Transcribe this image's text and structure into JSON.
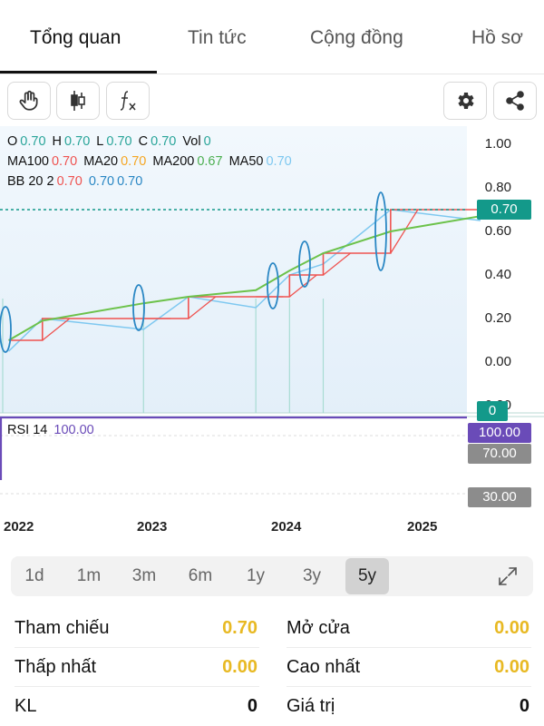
{
  "tabs": [
    {
      "label": "Tổng quan",
      "active": true
    },
    {
      "label": "Tin tức",
      "active": false
    },
    {
      "label": "Cộng đồng",
      "active": false
    },
    {
      "label": "Hồ sơ",
      "active": false
    }
  ],
  "toolbar": {
    "icons": [
      "hand-icon",
      "candlestick-icon",
      "function-icon",
      "gear-icon",
      "share-icon"
    ]
  },
  "legend": {
    "o_label": "O",
    "o_val": "0.70",
    "h_label": "H",
    "h_val": "0.70",
    "l_label": "L",
    "l_val": "0.70",
    "c_label": "C",
    "c_val": "0.70",
    "vol_label": "Vol",
    "vol_val": "0",
    "ma100_label": "MA100",
    "ma100_val": "0.70",
    "ma20_label": "MA20",
    "ma20_val": "0.70",
    "ma200_label": "MA200",
    "ma200_val": "0.67",
    "ma50_label": "MA50",
    "ma50_val": "0.70",
    "bb_label": "BB 20 2",
    "bb_upper": "0.70",
    "bb_mid": "0.70",
    "bb_lower": "0.70"
  },
  "price_axis": {
    "ticks": [
      "1.00",
      "0.80",
      "0.60",
      "0.40",
      "0.20",
      "0.00",
      "-0.20"
    ],
    "current_price": "0.70",
    "volume_badge": "0"
  },
  "rsi": {
    "label": "RSI 14",
    "value": "100.00",
    "upper_band": "70.00",
    "lower_band": "30.00"
  },
  "years": [
    "2022",
    "2023",
    "2024",
    "2025"
  ],
  "ranges": [
    {
      "label": "1d",
      "active": false
    },
    {
      "label": "1m",
      "active": false
    },
    {
      "label": "3m",
      "active": false
    },
    {
      "label": "6m",
      "active": false
    },
    {
      "label": "1y",
      "active": false
    },
    {
      "label": "3y",
      "active": false
    },
    {
      "label": "5y",
      "active": true
    }
  ],
  "stats": {
    "ref_label": "Tham chiếu",
    "ref_val": "0.70",
    "open_label": "Mở cửa",
    "open_val": "0.00",
    "low_label": "Thấp nhất",
    "low_val": "0.00",
    "high_label": "Cao nhất",
    "high_val": "0.00",
    "vol_label": "KL",
    "vol_val": "0",
    "value_label": "Giá trị",
    "value_val": "0"
  },
  "chart_data": {
    "type": "line",
    "ylim": [
      -0.2,
      1.0
    ],
    "series": [
      {
        "name": "C",
        "values": [
          0.1,
          0.2,
          0.2,
          0.3,
          0.3,
          0.4,
          0.5,
          0.7,
          0.7
        ]
      },
      {
        "name": "MA200",
        "values": [
          0.1,
          0.19,
          0.27,
          0.3,
          0.33,
          0.42,
          0.5,
          0.6,
          0.67
        ]
      }
    ],
    "x": [
      "2021-12",
      "2022-03",
      "2022-12",
      "2023-04",
      "2023-10",
      "2024-01",
      "2024-04",
      "2024-10",
      "2025-06"
    ],
    "colors": {
      "price": "#ef5350",
      "ma200": "#6cc24a",
      "bb": "#7ec8f0",
      "rsi": "#6a4bb8",
      "current": "#13998a"
    }
  }
}
